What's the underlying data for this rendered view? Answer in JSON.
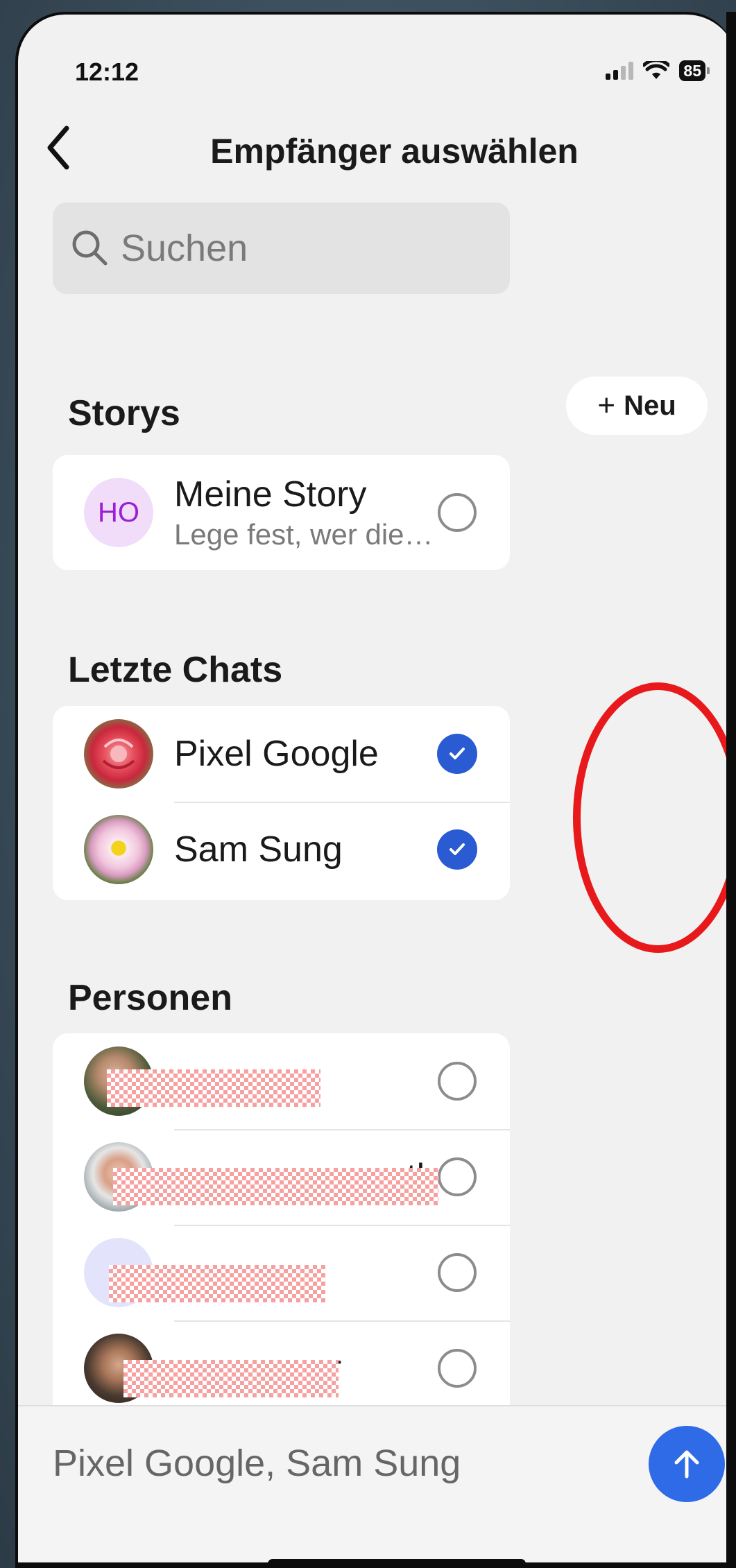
{
  "status": {
    "time": "12:12",
    "battery": "85"
  },
  "header": {
    "title": "Empfänger auswählen"
  },
  "search": {
    "placeholder": "Suchen"
  },
  "stories": {
    "section_title": "Storys",
    "new_label": "Neu",
    "items": [
      {
        "initials": "HO",
        "name": "Meine Story",
        "subtitle": "Lege fest, wer diese Story s…",
        "selected": false
      }
    ]
  },
  "recent_chats": {
    "section_title": "Letzte Chats",
    "items": [
      {
        "name": "Pixel Google",
        "selected": true
      },
      {
        "name": "Sam Sung",
        "selected": true
      }
    ]
  },
  "people": {
    "section_title": "Personen",
    "items": [
      {
        "name_visible": "",
        "selected": false
      },
      {
        "name_visible": "th",
        "selected": false
      },
      {
        "name_visible": "",
        "selected": false
      },
      {
        "name_visible": "er",
        "selected": false
      }
    ]
  },
  "footer": {
    "selected_recipients": "Pixel Google, Sam Sung"
  },
  "colors": {
    "accent": "#2f6be6",
    "check": "#2a5bd3",
    "highlight": "#e8191b"
  }
}
